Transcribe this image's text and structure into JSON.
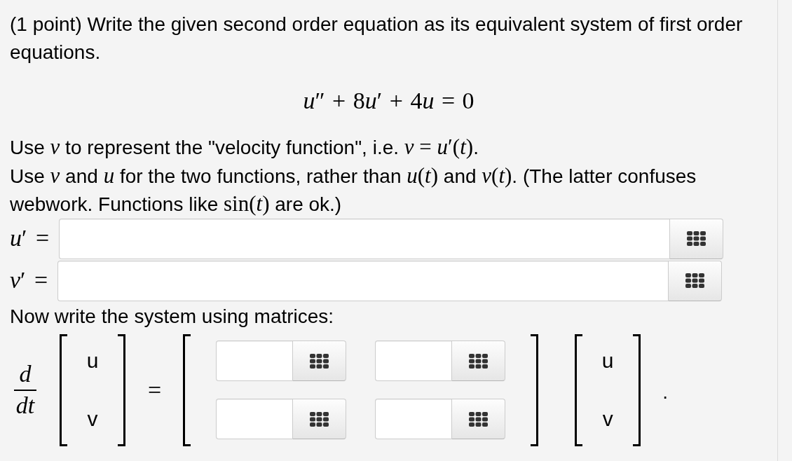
{
  "problem": {
    "statement": "(1 point) Write the given second order equation as its equivalent system of first order equations.",
    "equation": {
      "segments": [
        {
          "kind": "math",
          "text": "*u*″ + 8"
        },
        {
          "kind": "math",
          "text": "*u*′ + 4"
        },
        {
          "kind": "math",
          "text": "*u* = 0"
        }
      ]
    }
  },
  "instructions": [
    {
      "segments": [
        {
          "kind": "text",
          "text": "Use "
        },
        {
          "kind": "math",
          "text": "*v*"
        },
        {
          "kind": "text",
          "text": " to represent the \"velocity function\", i.e. "
        },
        {
          "kind": "math",
          "text": "*v* = *u*′(*t*)"
        },
        {
          "kind": "text",
          "text": "."
        }
      ]
    },
    {
      "segments": [
        {
          "kind": "text",
          "text": "Use "
        },
        {
          "kind": "math",
          "text": "*v*"
        },
        {
          "kind": "text",
          "text": " and "
        },
        {
          "kind": "math",
          "text": "*u*"
        },
        {
          "kind": "text",
          "text": " for the two functions, rather than "
        },
        {
          "kind": "math",
          "text": "*u*(*t*)"
        },
        {
          "kind": "text",
          "text": " and "
        },
        {
          "kind": "math",
          "text": "*v*(*t*)"
        },
        {
          "kind": "text",
          "text": ". (The latter confuses webwork. Functions like "
        },
        {
          "kind": "math",
          "text": "sin(*t*)"
        },
        {
          "kind": "text",
          "text": " are ok.)"
        }
      ]
    }
  ],
  "answers": [
    {
      "label": "*u*′ =",
      "kind": "input-with-palette"
    },
    {
      "label": "*v*′ =",
      "kind": "input-with-palette"
    }
  ],
  "matrix_form": {
    "heading": "Now write the system using matrices:",
    "derivative": {
      "numerator": "d",
      "denominator": "dt"
    },
    "vector": [
      "u",
      "v"
    ],
    "equals": "=",
    "matrix": [
      [
        {
          "kind": "input-with-palette"
        },
        {
          "kind": "input-with-palette"
        }
      ],
      [
        {
          "kind": "input-with-palette"
        },
        {
          "kind": "input-with-palette"
        }
      ]
    ],
    "result_vector": [
      "u",
      "v"
    ],
    "end_mark": "."
  }
}
